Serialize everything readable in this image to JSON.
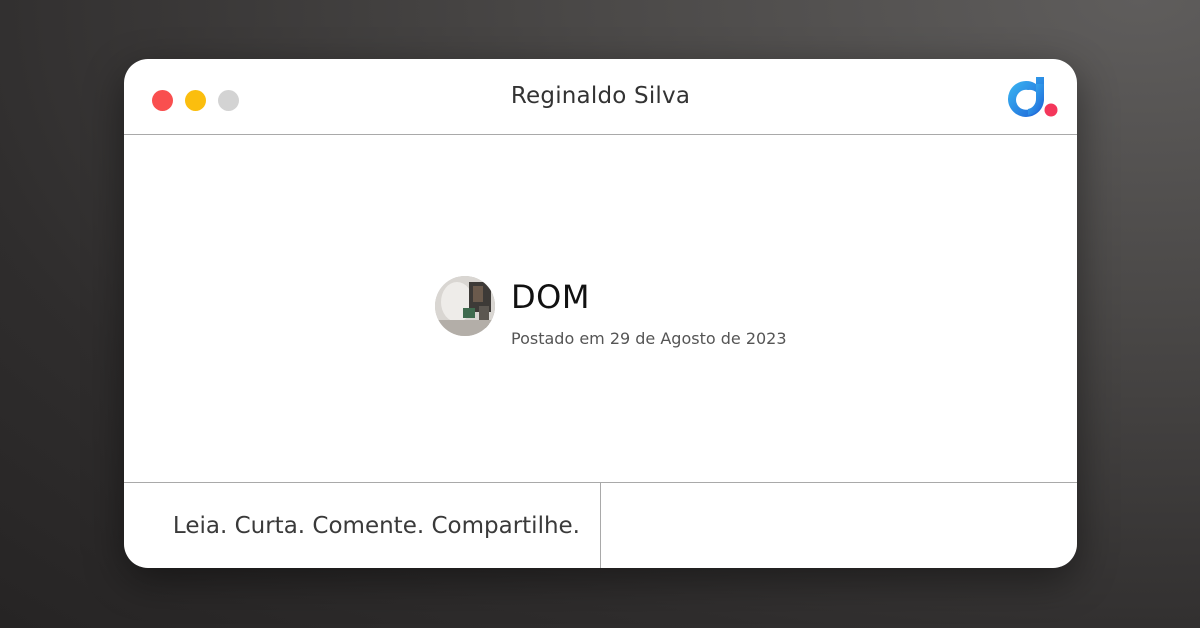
{
  "window": {
    "title": "Reginaldo Silva",
    "controls": [
      {
        "name": "close",
        "color": "#f94f4f"
      },
      {
        "name": "minimize",
        "color": "#fbbe0e"
      },
      {
        "name": "maximize",
        "color": "#d3d3d3"
      }
    ],
    "logo": {
      "icon": "dio-logo-icon",
      "colors": {
        "gradient_start": "#3bbcf4",
        "gradient_end": "#1d5fd6",
        "accent_dot": "#f4375b"
      }
    }
  },
  "post": {
    "title": "DOM",
    "date": "Postado em 29 de Agosto de 2023",
    "avatar_icon": "author-avatar"
  },
  "footer": {
    "tagline": "Leia. Curta. Comente. Compartilhe."
  }
}
